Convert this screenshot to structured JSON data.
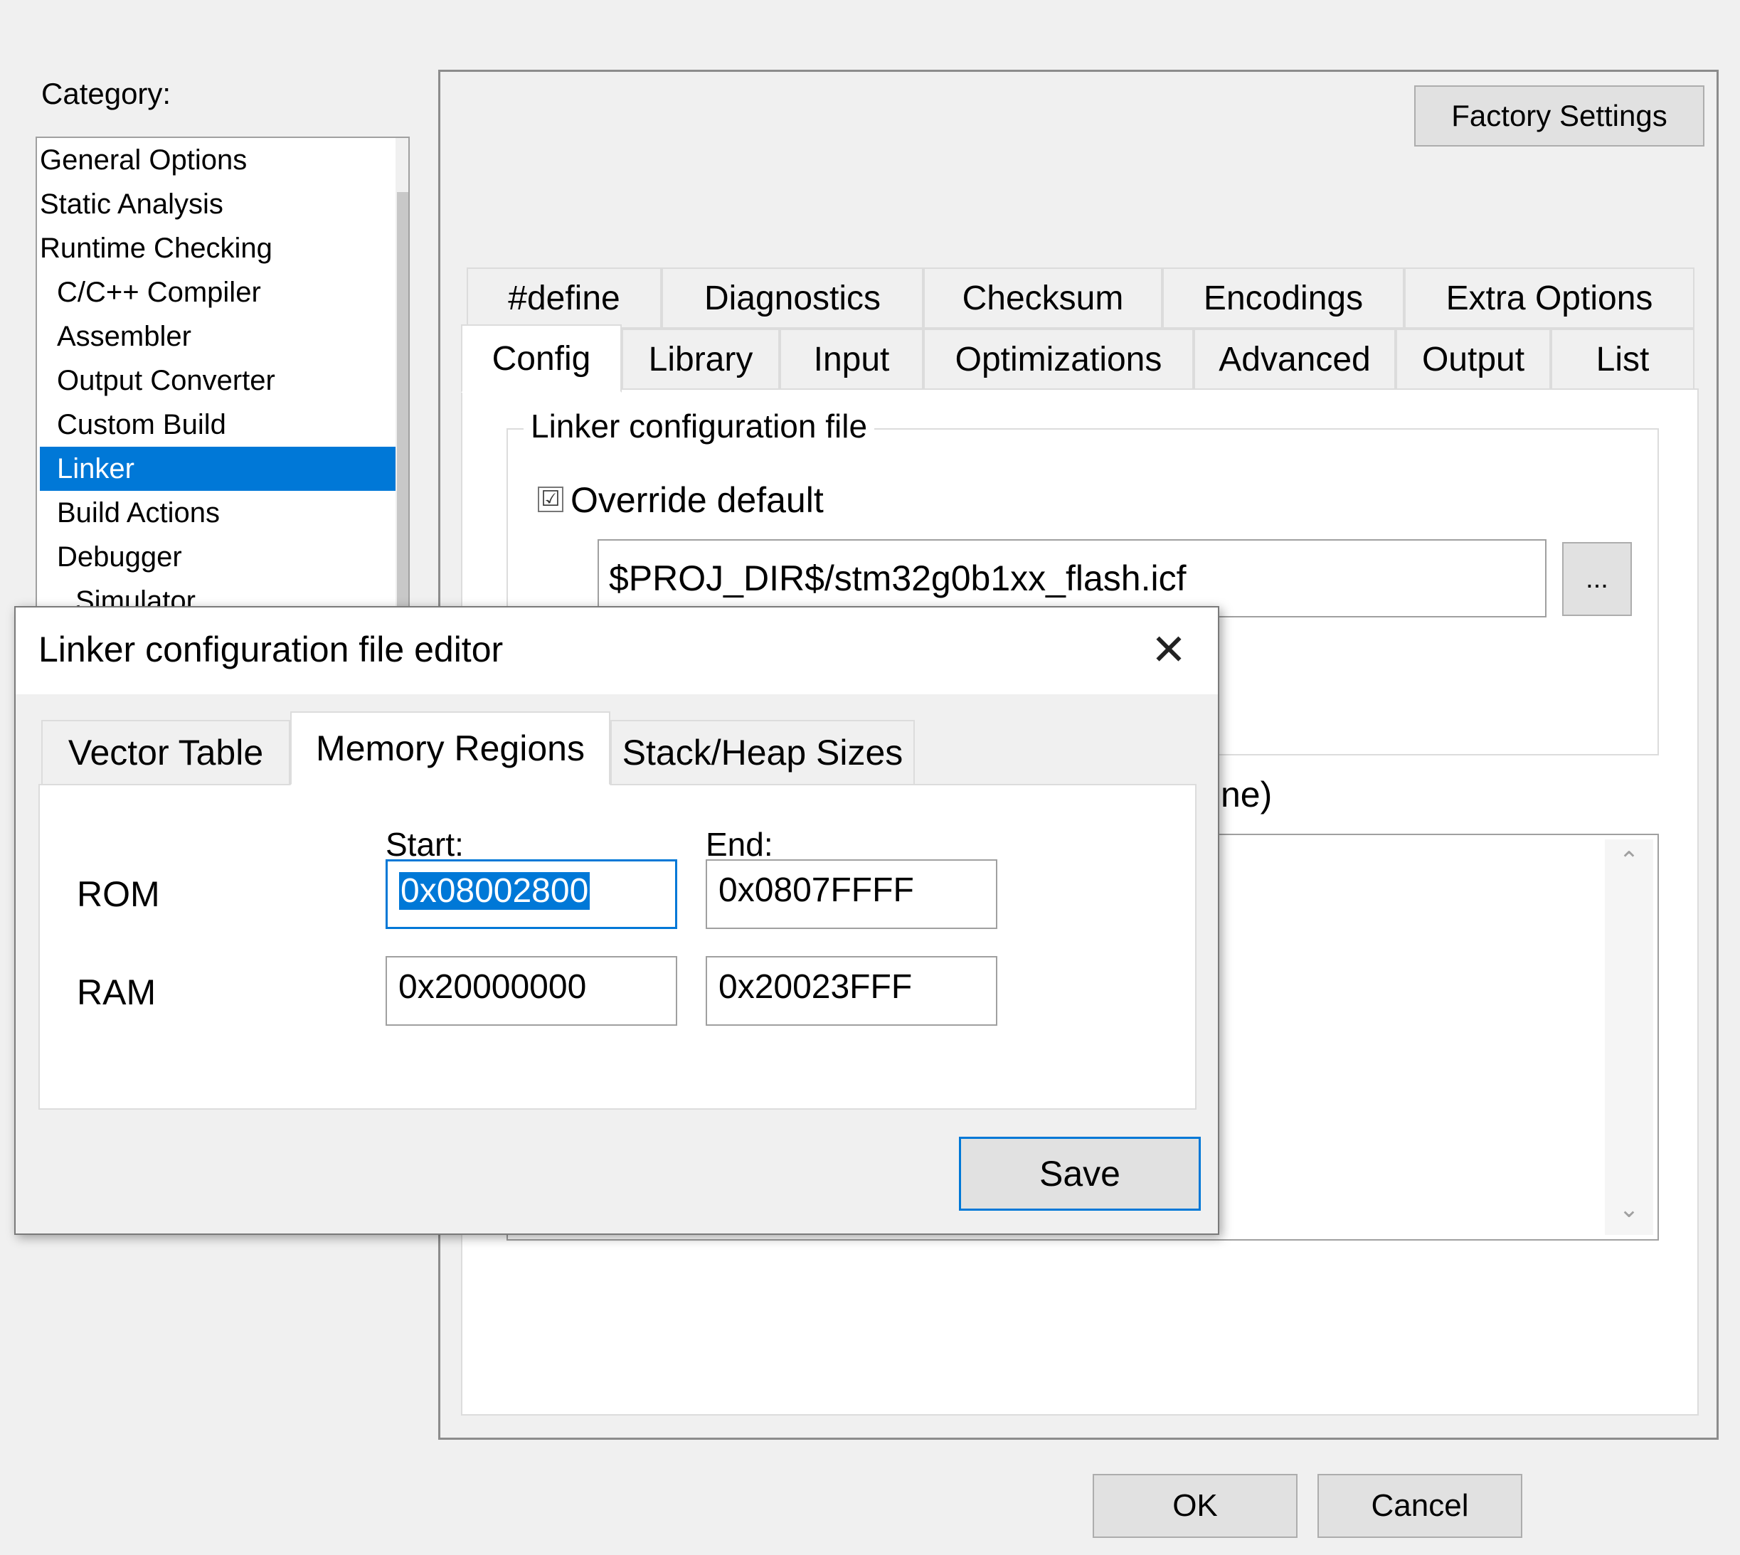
{
  "category": {
    "label": "Category:",
    "items": [
      {
        "label": "General Options",
        "indent": false,
        "selected": false
      },
      {
        "label": "Static Analysis",
        "indent": false,
        "selected": false
      },
      {
        "label": "Runtime Checking",
        "indent": false,
        "selected": false
      },
      {
        "label": "C/C++ Compiler",
        "indent": true,
        "selected": false
      },
      {
        "label": "Assembler",
        "indent": true,
        "selected": false
      },
      {
        "label": "Output Converter",
        "indent": true,
        "selected": false
      },
      {
        "label": "Custom Build",
        "indent": true,
        "selected": false
      },
      {
        "label": "Linker",
        "indent": true,
        "selected": true
      },
      {
        "label": "Build Actions",
        "indent": true,
        "selected": false
      },
      {
        "label": "Debugger",
        "indent": true,
        "selected": false
      },
      {
        "label": "Simulator",
        "indent": true,
        "selected": false
      }
    ]
  },
  "options_panel": {
    "factory_settings_label": "Factory Settings",
    "tabs_row1": [
      "#define",
      "Diagnostics",
      "Checksum",
      "Encodings",
      "Extra Options"
    ],
    "tabs_row2": [
      "Config",
      "Library",
      "Input",
      "Optimizations",
      "Advanced",
      "Output",
      "List"
    ],
    "active_tab": "Config",
    "linker_config_group_label": "Linker configuration file",
    "override_default_label": "Override default",
    "override_default_checked": true,
    "override_check_glyph": "☑",
    "icf_path": "$PROJ_DIR$/stm32g0b1xx_flash.icf",
    "browse_label": "...",
    "partial_label": "ne)"
  },
  "footer": {
    "ok_label": "OK",
    "cancel_label": "Cancel"
  },
  "dialog": {
    "title": "Linker configuration file editor",
    "close_glyph": "✕",
    "tabs": [
      "Vector Table",
      "Memory Regions",
      "Stack/Heap Sizes"
    ],
    "active_tab": "Memory Regions",
    "start_label": "Start:",
    "end_label": "End:",
    "regions": [
      {
        "name": "ROM",
        "start": "0x08002800",
        "end": "0x0807FFFF"
      },
      {
        "name": "RAM",
        "start": "0x20000000",
        "end": "0x20023FFF"
      }
    ],
    "save_label": "Save"
  },
  "colors": {
    "selection": "#0078d7",
    "background": "#f0f0f0"
  }
}
